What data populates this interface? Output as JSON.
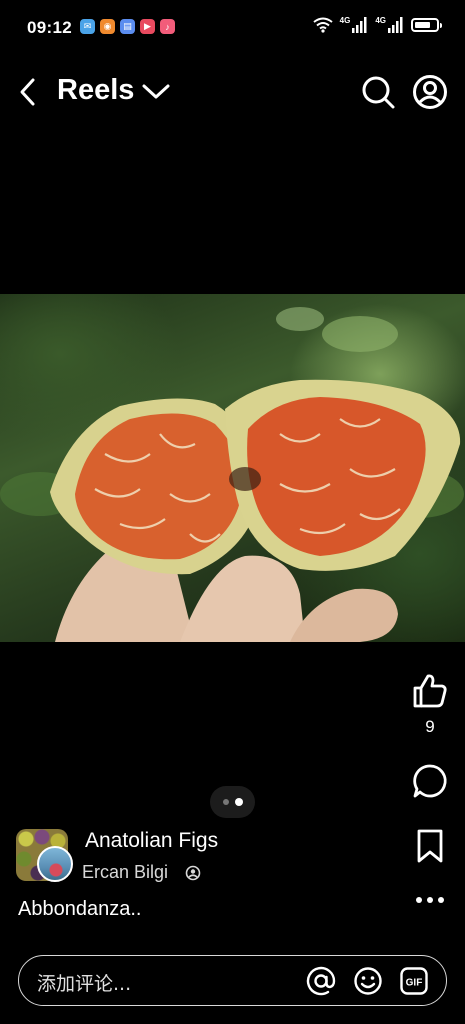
{
  "status_bar": {
    "time": "09:12",
    "network_1": "4G",
    "network_2": "4G",
    "battery_level": 0.75,
    "app_icons": [
      {
        "name": "mail-app-icon",
        "color": "#4aa3e8"
      },
      {
        "name": "camera-app-icon",
        "color": "#f08a2e"
      },
      {
        "name": "files-app-icon",
        "color": "#5b8def"
      },
      {
        "name": "video-app-icon",
        "color": "#e84a5f"
      },
      {
        "name": "music-app-icon",
        "color": "#f25c7a"
      }
    ]
  },
  "header": {
    "title": "Reels"
  },
  "post": {
    "group_name": "Anatolian Figs",
    "author_name": "Ercan Bilgi",
    "caption": "Abbondanza..",
    "like_count": "9",
    "page_count": 2,
    "active_page": 2
  },
  "comment_bar": {
    "placeholder": "添加评论..."
  },
  "colors": {
    "background": "#000000",
    "text": "#ffffff"
  }
}
